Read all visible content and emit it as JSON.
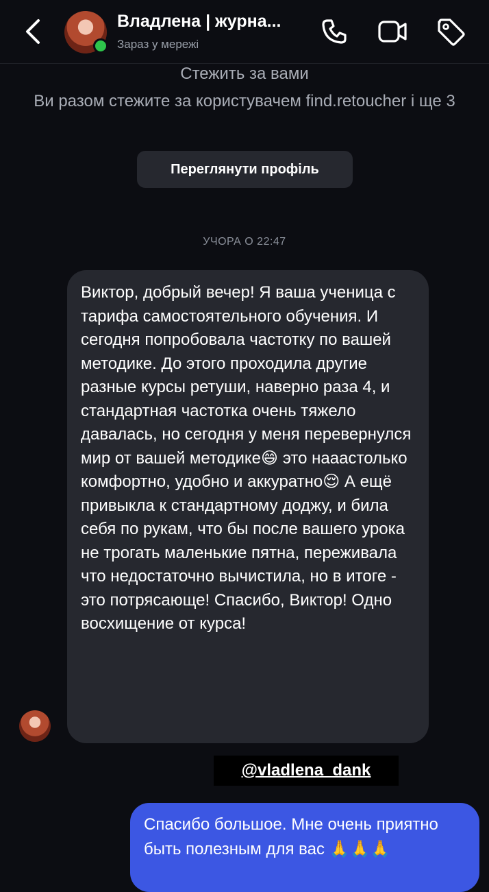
{
  "header": {
    "title": "Владлена | журна...",
    "status": "Зараз у мережі",
    "icons": [
      "back-chevron-icon",
      "phone-icon",
      "video-call-icon",
      "tag-icon"
    ]
  },
  "follow_info": {
    "title": "Стежить за вами",
    "subtitle": "Ви разом стежите за користувачем find.retoucher і ще 3",
    "button_label": "Переглянути профіль"
  },
  "timestamp": "УЧОРА О 22:47",
  "messages": [
    {
      "direction": "incoming",
      "text": "Виктор, добрый вечер! Я ваша ученица с тарифа самостоятельного обучения. И сегодня попробовала частотку по вашей методике. До этого проходила другие разные курсы ретуши, наверно раза 4, и стандартная частотка очень тяжело давалась, но сегодня у меня перевернулся мир от вашей методике😄 это нааастолько комфортно, удобно и аккуратно😌 А ещё привыкла к стандартному доджу, и била себя по рукам, что бы после вашего урока не трогать маленькие пятна, переживала что недостаточно вычистила, но в итоге - это потрясающе! Спасибо, Виктор! Одно восхищение от курса!"
    },
    {
      "direction": "outgoing",
      "text": "Спасибо большое. Мне очень приятно быть полезным для вас 🙏🙏🙏"
    }
  ],
  "watermark": "@vladlena_dank",
  "colors": {
    "background": "#0c0d12",
    "incoming_bubble": "#26282f",
    "outgoing_bubble": "#3c57e3",
    "online": "#2ec54b"
  }
}
